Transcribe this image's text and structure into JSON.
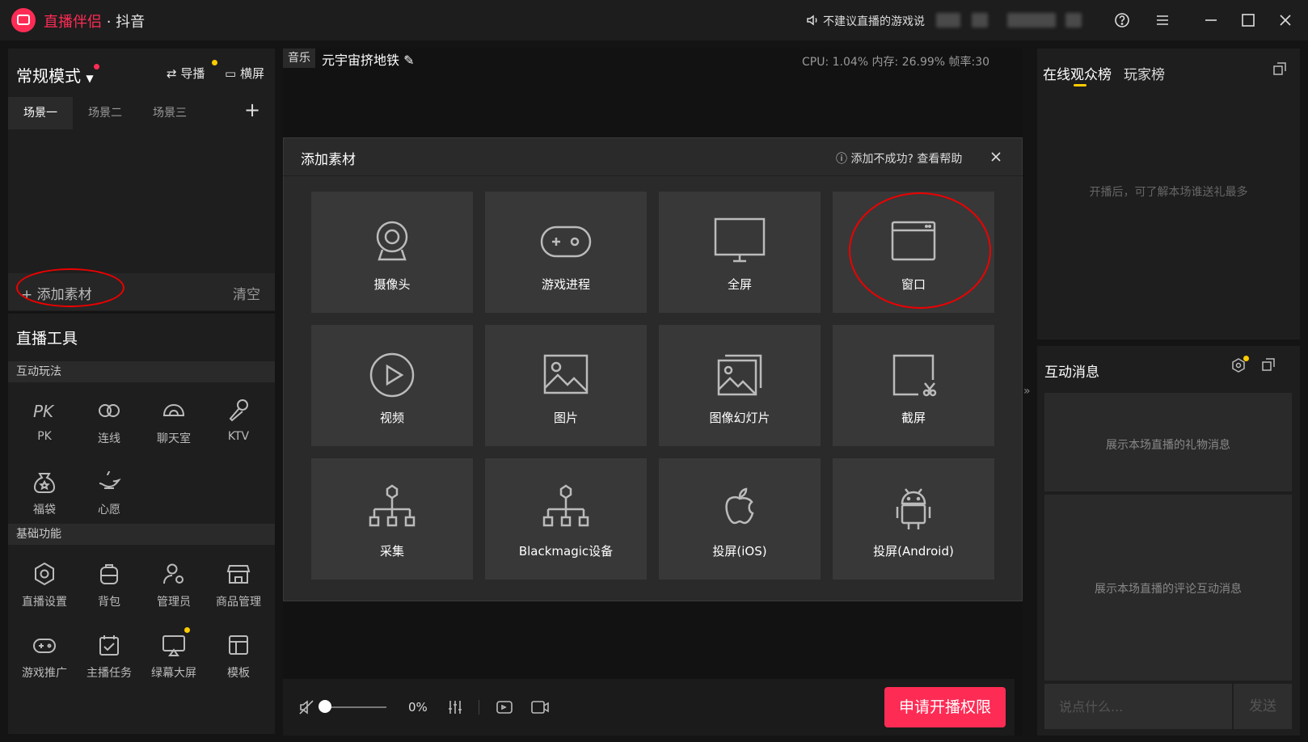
{
  "app": {
    "title_brand": "直播伴侣",
    "title_sep": " · ",
    "title_platform": "抖音",
    "notice": "不建议直播的游戏说"
  },
  "left": {
    "mode": "常规模式",
    "guide": "导播",
    "landscape": "横屏",
    "scenes": [
      "场景一",
      "场景二",
      "场景三"
    ],
    "add_material": "添加素材",
    "clear": "清空",
    "tools_title": "直播工具",
    "interactive_section": "互动玩法",
    "interactive_tools": [
      "PK",
      "连线",
      "聊天室",
      "KTV",
      "福袋",
      "心愿"
    ],
    "basic_section": "基础功能",
    "basic_tools": [
      "直播设置",
      "背包",
      "管理员",
      "商品管理",
      "游戏推广",
      "主播任务",
      "绿幕大屏",
      "模板"
    ]
  },
  "center": {
    "music_tag": "音乐",
    "song": "元宇宙挤地铁",
    "stats": "CPU: 1.04%   内存: 26.99%   帧率:30",
    "volume_pct": "0%",
    "go_live": "申请开播权限"
  },
  "dialog": {
    "title": "添加素材",
    "help": "添加不成功? 查看帮助",
    "cards": [
      "摄像头",
      "游戏进程",
      "全屏",
      "窗口",
      "视频",
      "图片",
      "图像幻灯片",
      "截屏",
      "采集",
      "Blackmagic设备",
      "投屏(iOS)",
      "投屏(Android)"
    ]
  },
  "right": {
    "tab_online": "在线观众榜",
    "tab_players": "玩家榜",
    "rank_hint": "开播后，可了解本场谁送礼最多",
    "msg_title": "互动消息",
    "gift_hint": "展示本场直播的礼物消息",
    "comment_hint": "展示本场直播的评论互动消息",
    "chat_placeholder": "说点什么...",
    "send": "发送"
  },
  "colors": {
    "brand": "#fe2c55",
    "highlight_oval": "#e00000",
    "badge_yellow": "#ffcc00"
  }
}
